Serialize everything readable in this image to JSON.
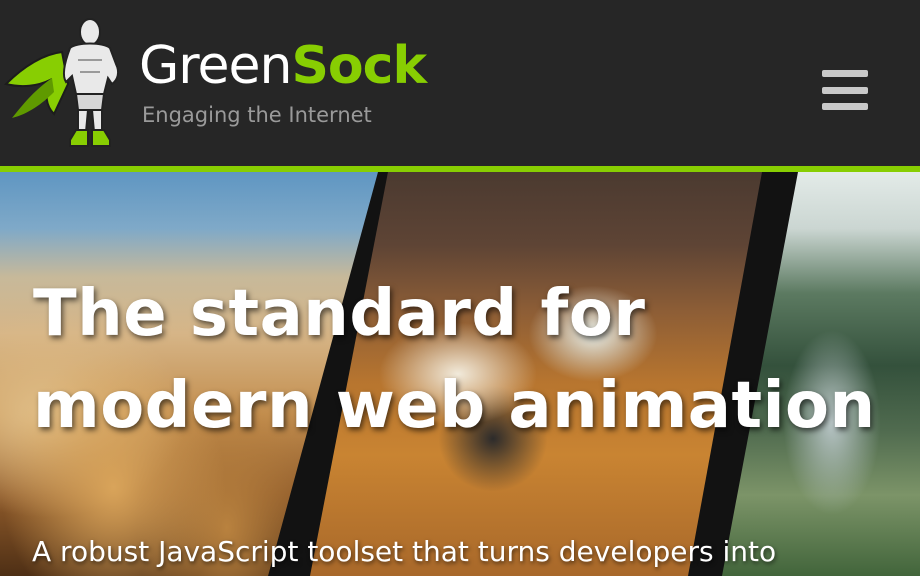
{
  "header": {
    "brand_part1": "Green",
    "brand_part2": "Sock",
    "tagline": "Engaging the Internet",
    "menu_icon": "hamburger-menu-icon",
    "accent_color": "#88ce02",
    "background_color": "#262626"
  },
  "hero": {
    "headline_line1": "The standard for",
    "headline_line2": "modern web animation",
    "subheadline": "A robust JavaScript toolset that turns developers into",
    "images": [
      "beach-photo",
      "desk-photo",
      "forest-river-photo"
    ]
  }
}
